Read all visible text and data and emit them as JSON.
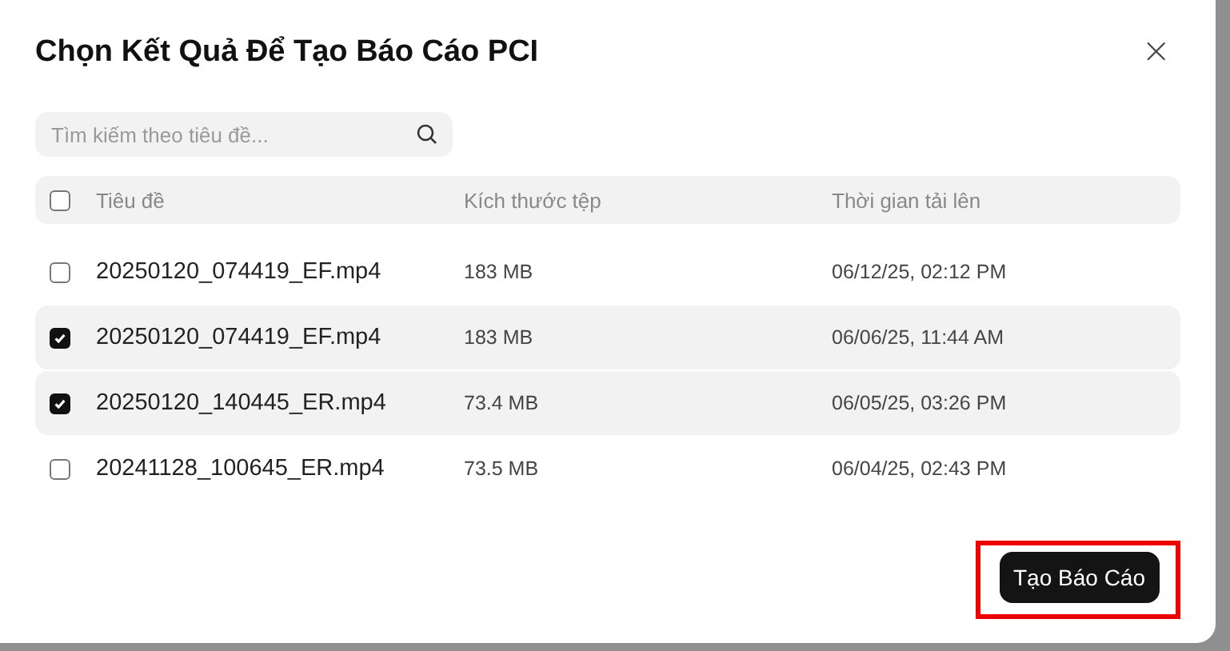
{
  "dialog": {
    "title": "Chọn Kết Quả Để Tạo Báo Cáo PCI",
    "close": "×"
  },
  "search": {
    "placeholder": "Tìm kiếm theo tiêu đề..."
  },
  "table": {
    "select_all": {
      "checked": false
    },
    "columns": [
      "Tiêu đề",
      "Kích thước tệp",
      "Thời gian tải lên"
    ],
    "rows": [
      {
        "title": "20250120_074419_EF.mp4",
        "size": "183 MB",
        "uploaded": "06/12/25, 02:12 PM",
        "checked": false
      },
      {
        "title": "20250120_074419_EF.mp4",
        "size": "183 MB",
        "uploaded": "06/06/25, 11:44 AM",
        "checked": true
      },
      {
        "title": "20250120_140445_ER.mp4",
        "size": "73.4 MB",
        "uploaded": "06/05/25, 03:26 PM",
        "checked": true
      },
      {
        "title": "20241128_100645_ER.mp4",
        "size": "73.5 MB",
        "uploaded": "06/04/25, 02:43 PM",
        "checked": false
      }
    ]
  },
  "button": {
    "label": "Tạo Báo Cáo",
    "highlighted": true
  }
}
